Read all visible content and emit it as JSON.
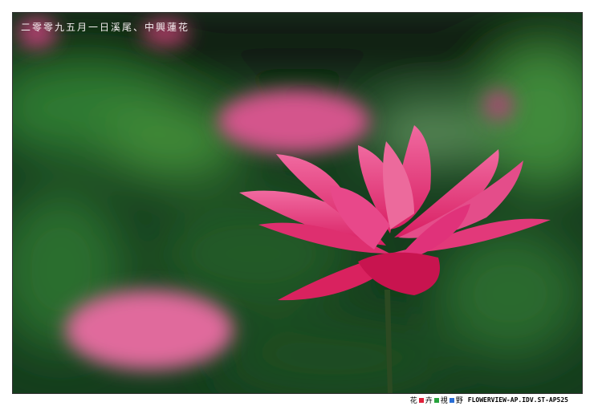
{
  "caption": "二零零九五月一日溪尾、中興蓮花",
  "footer": {
    "chars": [
      "花",
      "卉",
      "視",
      "野"
    ],
    "square_colors": [
      "#e0203a",
      "#27a33c",
      "#2a6fd6"
    ],
    "url": "FLOWERVIEW-AP.IDV.ST-AP525"
  },
  "colors": {
    "petal": "#e8387a",
    "background": "#123a1a"
  }
}
